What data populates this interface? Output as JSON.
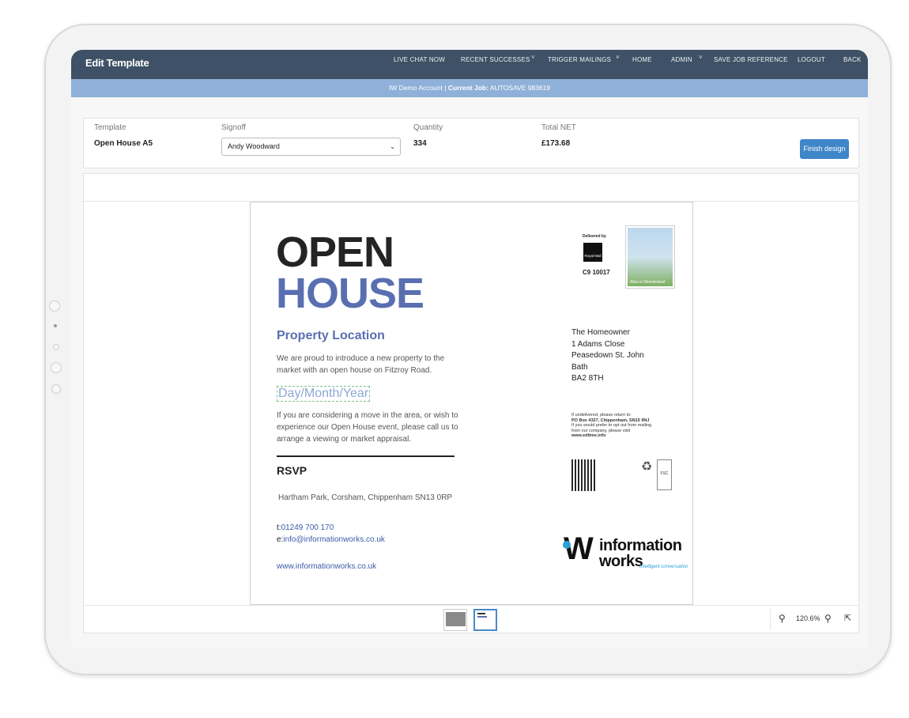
{
  "topbar": {
    "title": "Edit Template",
    "nav": {
      "live_chat": "LIVE CHAT NOW",
      "recent_successes": "RECENT SUCCESSES",
      "trigger_mailings": "TRIGGER MAILINGS",
      "home": "HOME",
      "admin": "ADMIN",
      "save_job_reference": "SAVE JOB REFERENCE",
      "logout": "LOGOUT",
      "back": "BACK"
    }
  },
  "subbar": {
    "account": "IW Demo Account |",
    "current_job_label": "Current Job:",
    "current_job_value": "AUTOSAVE 983619"
  },
  "summary": {
    "template_label": "Template",
    "template_value": "Open House A5",
    "signoff_label": "Signoff",
    "signoff_value": "Andy Woodward",
    "quantity_label": "Quantity",
    "quantity_value": "334",
    "total_label": "Total NET",
    "total_value": "£173.68",
    "finish_button": "Finish design"
  },
  "document": {
    "title_line1": "OPEN",
    "title_line2": "HOUSE",
    "property_heading": "Property Location",
    "intro_line1": "We are proud to introduce a new property to the",
    "intro_line2": "market with an open house on Fitzroy Road.",
    "date_placeholder": "Day/Month/Year",
    "body_line1": "If you are considering a move in the area, or wish to",
    "body_line2": "experience our Open House event, please call us to",
    "body_line3": "arrange a viewing or market appraisal.",
    "rsvp": "RSVP",
    "rsvp_address": "Hartham Park, Corsham, Chippenham SN13 0RP",
    "phone_prefix": "t:",
    "phone": "01249 700 170",
    "email_prefix": "e:",
    "email": "info@informationworks.co.uk",
    "website": "www.informationworks.co.uk",
    "delivered_by": "Delivered by",
    "royal_mail": "Royal Mail",
    "licence": "C9 10017",
    "stamp_caption": "Alice in Wonderland",
    "address": {
      "line1": "The Homeowner",
      "line2": "1 Adams Close",
      "line3": "Peasedown St. John",
      "line4": "Bath",
      "line5": "BA2 8TH"
    },
    "return": {
      "line1": "If undelivered, please return to:",
      "line2": "PO Box 4327, Chippenham, SN15 9NJ",
      "line3": "If you would prefer to opt out from mailing",
      "line4": "from our company, please visit",
      "line5": "www.editme.info"
    },
    "fsc": "FSC",
    "logo": {
      "line1": "information",
      "line2": "works",
      "tagline": "Intelligent conversation"
    }
  },
  "footer": {
    "zoom_value": "120.6%"
  }
}
